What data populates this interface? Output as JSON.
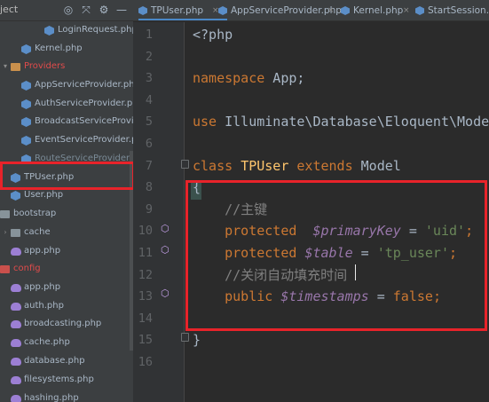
{
  "sidebar": {
    "header_title": "ject",
    "header_icons": [
      "target-icon",
      "collapse-all-icon",
      "settings-icon",
      "hide-icon"
    ],
    "items": [
      {
        "label": "LoginRequest.php",
        "icon": "php-icon",
        "type": "file"
      },
      {
        "label": "Kernel.php",
        "icon": "php-icon",
        "type": "file"
      },
      {
        "label": "Providers",
        "icon": "folder-icon",
        "type": "folder"
      },
      {
        "label": "AppServiceProvider.php",
        "icon": "php-icon",
        "type": "file"
      },
      {
        "label": "AuthServiceProvider.php",
        "icon": "php-icon",
        "type": "file"
      },
      {
        "label": "BroadcastServiceProvider.",
        "icon": "php-icon",
        "type": "file"
      },
      {
        "label": "EventServiceProvider.php",
        "icon": "php-icon",
        "type": "file"
      },
      {
        "label": "RouteServiceProvider.php",
        "icon": "php-icon",
        "type": "file"
      },
      {
        "label": "TPUser.php",
        "icon": "php-icon",
        "type": "file"
      },
      {
        "label": "User.php",
        "icon": "php-icon",
        "type": "file"
      },
      {
        "label": "bootstrap",
        "icon": "folder-icon",
        "type": "folder"
      },
      {
        "label": "cache",
        "icon": "folder-icon",
        "type": "folder"
      },
      {
        "label": "app.php",
        "icon": "elephant-icon",
        "type": "file"
      },
      {
        "label": "config",
        "icon": "folder-icon",
        "type": "folder"
      },
      {
        "label": "app.php",
        "icon": "elephant-icon",
        "type": "file"
      },
      {
        "label": "auth.php",
        "icon": "elephant-icon",
        "type": "file"
      },
      {
        "label": "broadcasting.php",
        "icon": "elephant-icon",
        "type": "file"
      },
      {
        "label": "cache.php",
        "icon": "elephant-icon",
        "type": "file"
      },
      {
        "label": "database.php",
        "icon": "elephant-icon",
        "type": "file"
      },
      {
        "label": "filesystems.php",
        "icon": "elephant-icon",
        "type": "file"
      },
      {
        "label": "hashing.php",
        "icon": "elephant-icon",
        "type": "file"
      }
    ],
    "selected": "TPUser.php"
  },
  "tabs": [
    {
      "label": "TPUser.php",
      "close": "×",
      "active": true
    },
    {
      "label": "AppServiceProvider.php",
      "close": "×",
      "active": false
    },
    {
      "label": "Kernel.php",
      "close": "×",
      "active": false
    },
    {
      "label": "StartSession.php",
      "close": "",
      "active": false
    }
  ],
  "editor": {
    "line_numbers": [
      "1",
      "2",
      "3",
      "4",
      "5",
      "6",
      "7",
      "8",
      "9",
      "10",
      "11",
      "12",
      "13",
      "14",
      "15",
      "16"
    ],
    "lines": [
      [
        {
          "t": "<?php",
          "c": "plain"
        }
      ],
      [],
      [
        {
          "t": "namespace",
          "c": "kw"
        },
        {
          "t": " App;",
          "c": "plain"
        }
      ],
      [],
      [
        {
          "t": "use",
          "c": "kw"
        },
        {
          "t": " Illuminate\\Database\\Eloquent\\Model;",
          "c": "plain"
        }
      ],
      [],
      [
        {
          "t": "class",
          "c": "kw"
        },
        {
          "t": " ",
          "c": "plain"
        },
        {
          "t": "TPUser",
          "c": "cls"
        },
        {
          "t": " ",
          "c": "plain"
        },
        {
          "t": "extends",
          "c": "kw"
        },
        {
          "t": " Model",
          "c": "plain"
        }
      ],
      [
        {
          "t": "{",
          "c": "brace"
        }
      ],
      [
        {
          "t": "    //主键",
          "c": "cmt"
        }
      ],
      [
        {
          "t": "    ",
          "c": "plain"
        },
        {
          "t": "protected",
          "c": "kw"
        },
        {
          "t": "  ",
          "c": "plain"
        },
        {
          "t": "$primaryKey",
          "c": "var"
        },
        {
          "t": " = ",
          "c": "plain"
        },
        {
          "t": "'uid'",
          "c": "str"
        },
        {
          "t": ";",
          "c": "kw"
        }
      ],
      [
        {
          "t": "    ",
          "c": "plain"
        },
        {
          "t": "protected",
          "c": "kw"
        },
        {
          "t": " ",
          "c": "plain"
        },
        {
          "t": "$table",
          "c": "var"
        },
        {
          "t": " = ",
          "c": "plain"
        },
        {
          "t": "'tp_user'",
          "c": "str"
        },
        {
          "t": ";",
          "c": "kw"
        }
      ],
      [
        {
          "t": "    //关闭自动填充时间",
          "c": "cmt"
        }
      ],
      [
        {
          "t": "    ",
          "c": "plain"
        },
        {
          "t": "public",
          "c": "kw"
        },
        {
          "t": " ",
          "c": "plain"
        },
        {
          "t": "$timestamps",
          "c": "var"
        },
        {
          "t": " = ",
          "c": "plain"
        },
        {
          "t": "false",
          "c": "kw"
        },
        {
          "t": ";",
          "c": "kw"
        }
      ],
      [],
      [
        {
          "t": "}",
          "c": "plain"
        }
      ],
      []
    ]
  },
  "colors": {
    "highlight_box": "#e8232a",
    "keyword": "#cc7832",
    "variable": "#9876aa",
    "string": "#6a8759",
    "class_name": "#ffc66d",
    "comment": "#808080",
    "folder_label_red": "#e04b4b"
  }
}
